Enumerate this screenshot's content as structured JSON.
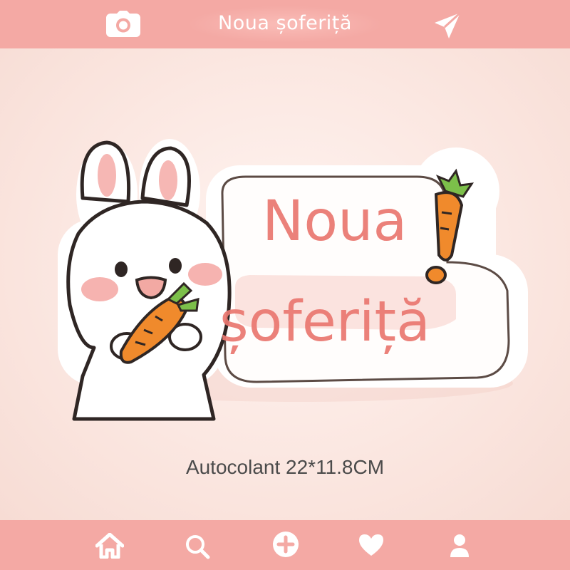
{
  "header": {
    "title": "Noua șoferiță",
    "left_icon": "camera-icon",
    "right_icon": "send-icon"
  },
  "sticker": {
    "line1": "Noua",
    "line2": "șoferiță",
    "characters": [
      "bunny",
      "carrot",
      "exclamation-mark"
    ]
  },
  "product": {
    "caption": "Autocolant 22*11.8CM"
  },
  "nav": {
    "items": [
      {
        "name": "home",
        "icon": "home-icon"
      },
      {
        "name": "search",
        "icon": "search-icon"
      },
      {
        "name": "add",
        "icon": "plus-circle-icon"
      },
      {
        "name": "favorites",
        "icon": "heart-icon"
      },
      {
        "name": "profile",
        "icon": "user-icon"
      }
    ]
  },
  "colors": {
    "bar": "#f4a9a4",
    "background": "#fbe6e0",
    "sticker_text": "#ea7871",
    "carrot": "#f08a2c",
    "caption": "#4b4b4b"
  }
}
